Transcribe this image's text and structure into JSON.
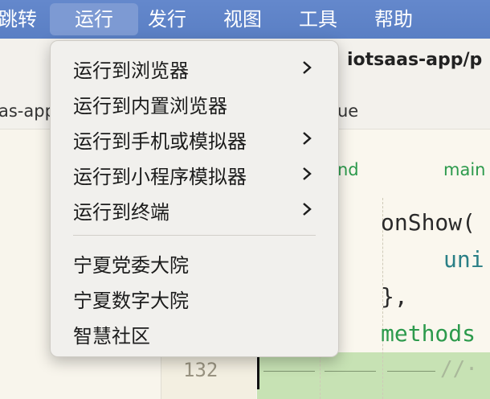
{
  "menubar": {
    "items": [
      {
        "label": "跳转"
      },
      {
        "label": "运行",
        "active": true
      },
      {
        "label": "发行"
      },
      {
        "label": "视图"
      },
      {
        "label": "工具"
      },
      {
        "label": "帮助"
      }
    ]
  },
  "editor": {
    "title": "iotsaas-app/p",
    "tab_left": "as-app",
    "tab_right": "ue",
    "green_words": [
      "nd",
      "main"
    ],
    "code_lines": [
      "onShow(",
      "uni",
      "},",
      "methods"
    ],
    "line_number": "132",
    "comment_fragment": "//·"
  },
  "run_menu": {
    "items": [
      {
        "label": "运行到浏览器",
        "submenu": true
      },
      {
        "label": "运行到内置浏览器",
        "submenu": false
      },
      {
        "label": "运行到手机或模拟器",
        "submenu": true
      },
      {
        "label": "运行到小程序模拟器",
        "submenu": true
      },
      {
        "label": "运行到终端",
        "submenu": true
      }
    ],
    "custom_items": [
      {
        "label": "宁夏党委大院"
      },
      {
        "label": "宁夏数字大院"
      },
      {
        "label": "智慧社区"
      }
    ]
  },
  "colors": {
    "menubar": "#5d82c8",
    "menu_active": "#7d9ad3",
    "keyword_green": "#2c9a4c",
    "code_teal": "#2a7f86",
    "highlight": "#c7e2b4"
  },
  "icons": {
    "submenu": "chevron-right-icon"
  }
}
